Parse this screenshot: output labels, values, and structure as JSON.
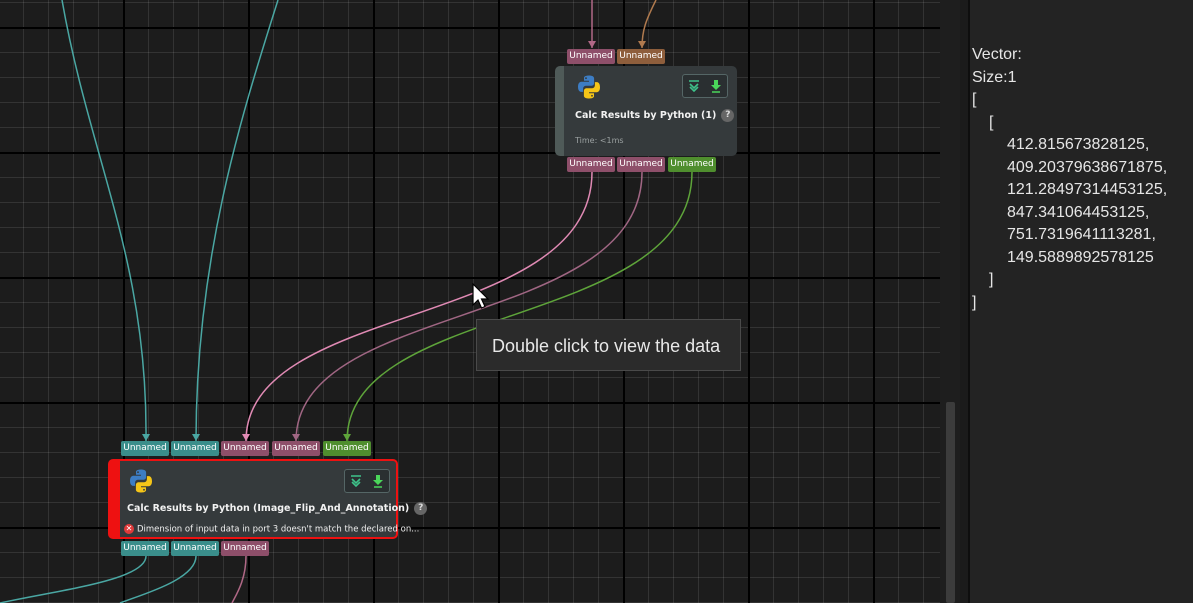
{
  "nodes": {
    "python1": {
      "title": "Calc Results by Python (1)",
      "time": "Time: <1ms",
      "inputs": [
        "Unnamed",
        "Unnamed"
      ],
      "outputs": [
        "Unnamed",
        "Unnamed",
        "Unnamed"
      ]
    },
    "python2": {
      "title": "Calc Results by Python (Image_Flip_And_Annotation)",
      "error": "Dimension of input data in port 3 doesn't match the declared on...",
      "inputs": [
        "Unnamed",
        "Unnamed",
        "Unnamed",
        "Unnamed",
        "Unnamed"
      ],
      "outputs": [
        "Unnamed",
        "Unnamed",
        "Unnamed"
      ]
    }
  },
  "help_symbol": "?",
  "error_symbol": "✕",
  "tooltip": "Double click to view the data",
  "panel": {
    "header": "Vector:",
    "size": "Size:1",
    "open_outer": "[",
    "open_inner": "[",
    "values": [
      "412.815673828125,",
      "409.20379638671875,",
      "121.28497314453125,",
      "847.341064453125,",
      "751.7319641113281,",
      "149.5889892578125"
    ],
    "close_inner": "]",
    "close_outer": "]"
  },
  "colors": {
    "port_teal": "#3a8e8b",
    "port_mauve": "#8e4f6a",
    "port_brown": "#8e5e3c",
    "port_green": "#4f8e2e",
    "error_red": "#e11111"
  }
}
